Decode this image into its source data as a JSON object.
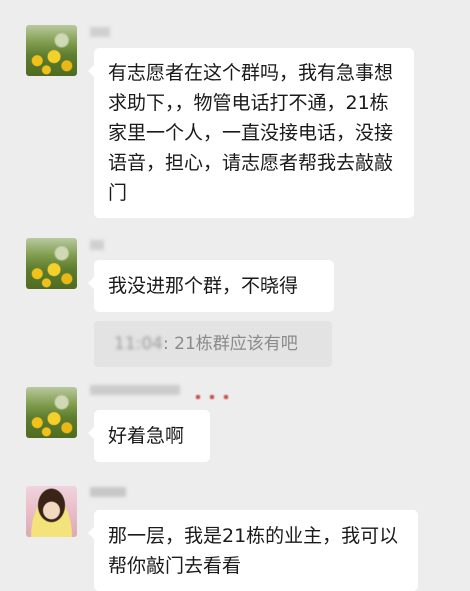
{
  "messages": [
    {
      "text": "有志愿者在这个群吗，我有急事想求助下，，物管电话打不通，21栋家里一个人，一直没接电话，没接语音，担心，请志愿者帮我去敲敲门"
    },
    {
      "text": "我没进那个群，不晓得",
      "quote": {
        "prefix": "11:04",
        "text": ": 21栋群应该有吧"
      }
    },
    {
      "text": "好着急啊"
    },
    {
      "text": "那一层，我是21栋的业主，我可以帮你敲门去看看"
    }
  ],
  "colors": {
    "background": "#ededed",
    "bubble": "#ffffff",
    "quote_bg": "#e3e3e3"
  },
  "icons": [
    "avatar-field-image",
    "avatar-person-image"
  ]
}
